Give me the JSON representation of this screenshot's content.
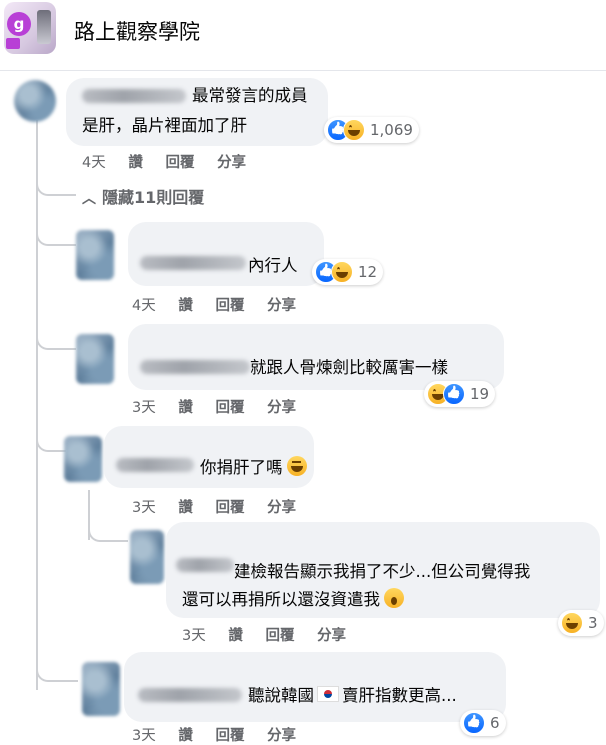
{
  "page": {
    "title": "路上觀察學院"
  },
  "comments": [
    {
      "text1": "最常發言的成員",
      "text2": "是肝，晶片裡面加了肝",
      "reaction_count": "1,069",
      "time": "4天",
      "like": "讚",
      "reply": "回覆",
      "share": "分享"
    },
    {
      "text": "內行人",
      "reaction_count": "12",
      "time": "4天",
      "like": "讚",
      "reply": "回覆",
      "share": "分享"
    },
    {
      "text": "就跟人骨煉劍比較厲害一樣",
      "reaction_count": "19",
      "time": "3天",
      "like": "讚",
      "reply": "回覆",
      "share": "分享"
    },
    {
      "text": "你捐肝了嗎",
      "time": "3天",
      "like": "讚",
      "reply": "回覆",
      "share": "分享"
    },
    {
      "text1": "建檢報告顯示我捐了不少...但公司覺得我",
      "text2": "還可以再捐所以還沒資遣我",
      "reaction_count": "3",
      "time": "3天",
      "like": "讚",
      "reply": "回覆",
      "share": "分享"
    },
    {
      "text_a": "聽說韓國",
      "text_b": "賣肝指數更高...",
      "reaction_count": "6",
      "time": "3天",
      "like": "讚",
      "reply": "回覆",
      "share": "分享"
    }
  ],
  "hide_replies": "隱藏11則回覆",
  "icons": {
    "like": "like-reaction-icon",
    "haha": "haha-reaction-icon",
    "wow": "wow-reaction-icon",
    "flag": "south-korea-flag-icon"
  },
  "colors": {
    "like_blue": "#0866ff",
    "bubble": "#f0f2f5",
    "meta": "#65676b"
  }
}
